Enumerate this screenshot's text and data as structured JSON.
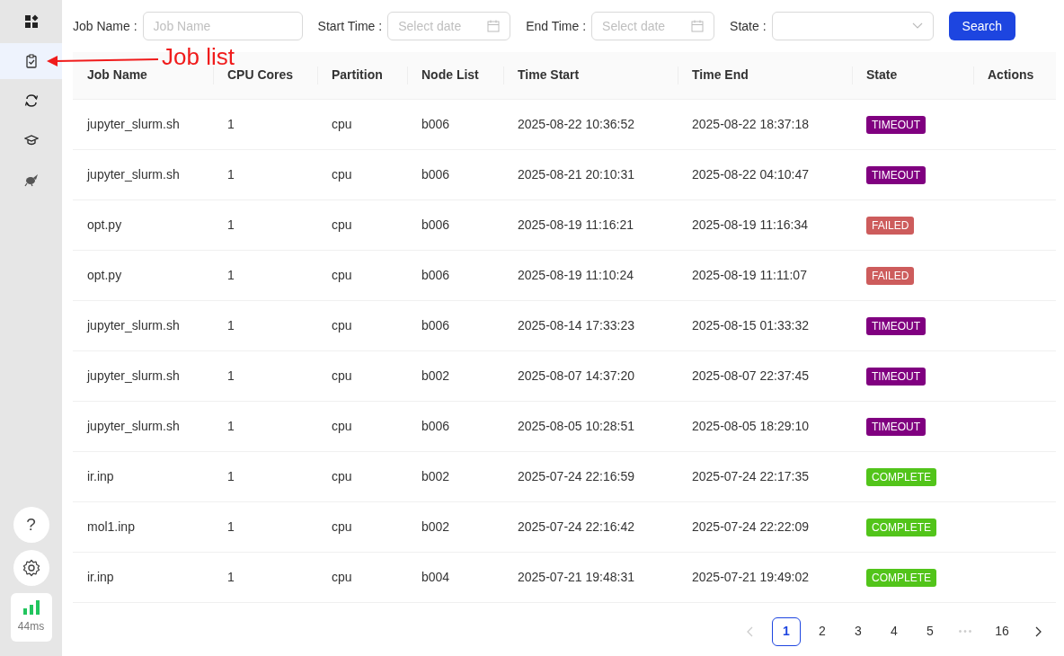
{
  "sidebar": {
    "items": [
      {
        "kind": "grid",
        "selected": false
      },
      {
        "kind": "clipboard",
        "selected": true
      },
      {
        "kind": "cycle",
        "selected": false
      },
      {
        "kind": "cap",
        "selected": false
      },
      {
        "kind": "bird",
        "selected": false
      }
    ],
    "bottom": [
      {
        "kind": "help",
        "text": "?"
      },
      {
        "kind": "settings"
      }
    ],
    "latency": "44ms"
  },
  "annotation": {
    "text": "Job list"
  },
  "filters": [
    {
      "kind": "text",
      "label": "Job Name :",
      "placeholder": "Job Name"
    },
    {
      "kind": "date",
      "label": "Start Time :",
      "placeholder": "Select date"
    },
    {
      "kind": "date",
      "label": "End Time :",
      "placeholder": "Select date"
    },
    {
      "kind": "select",
      "label": "State :"
    }
  ],
  "search_button": "Search",
  "table": {
    "columns": [
      "Job Name",
      "CPU Cores",
      "Partition",
      "Node List",
      "Time Start",
      "Time End",
      "State",
      "Actions"
    ],
    "rows": [
      {
        "job": "jupyter_slurm.sh",
        "cores": "1",
        "partition": "cpu",
        "nodes": "b006",
        "start": "2025-08-22 10:36:52",
        "end": "2025-08-22 18:37:18",
        "state": "TIMEOUT",
        "color": "#800080"
      },
      {
        "job": "jupyter_slurm.sh",
        "cores": "1",
        "partition": "cpu",
        "nodes": "b006",
        "start": "2025-08-21 20:10:31",
        "end": "2025-08-22 04:10:47",
        "state": "TIMEOUT",
        "color": "#800080"
      },
      {
        "job": "opt.py",
        "cores": "1",
        "partition": "cpu",
        "nodes": "b006",
        "start": "2025-08-19 11:16:21",
        "end": "2025-08-19 11:16:34",
        "state": "FAILED",
        "color": "#cd5c5c"
      },
      {
        "job": "opt.py",
        "cores": "1",
        "partition": "cpu",
        "nodes": "b006",
        "start": "2025-08-19 11:10:24",
        "end": "2025-08-19 11:11:07",
        "state": "FAILED",
        "color": "#cd5c5c"
      },
      {
        "job": "jupyter_slurm.sh",
        "cores": "1",
        "partition": "cpu",
        "nodes": "b006",
        "start": "2025-08-14 17:33:23",
        "end": "2025-08-15 01:33:32",
        "state": "TIMEOUT",
        "color": "#800080"
      },
      {
        "job": "jupyter_slurm.sh",
        "cores": "1",
        "partition": "cpu",
        "nodes": "b002",
        "start": "2025-08-07 14:37:20",
        "end": "2025-08-07 22:37:45",
        "state": "TIMEOUT",
        "color": "#800080"
      },
      {
        "job": "jupyter_slurm.sh",
        "cores": "1",
        "partition": "cpu",
        "nodes": "b006",
        "start": "2025-08-05 10:28:51",
        "end": "2025-08-05 18:29:10",
        "state": "TIMEOUT",
        "color": "#800080"
      },
      {
        "job": "ir.inp",
        "cores": "1",
        "partition": "cpu",
        "nodes": "b002",
        "start": "2025-07-24 22:16:59",
        "end": "2025-07-24 22:17:35",
        "state": "COMPLETE",
        "color": "#52c41a"
      },
      {
        "job": "mol1.inp",
        "cores": "1",
        "partition": "cpu",
        "nodes": "b002",
        "start": "2025-07-24 22:16:42",
        "end": "2025-07-24 22:22:09",
        "state": "COMPLETE",
        "color": "#52c41a"
      },
      {
        "job": "ir.inp",
        "cores": "1",
        "partition": "cpu",
        "nodes": "b004",
        "start": "2025-07-21 19:48:31",
        "end": "2025-07-21 19:49:02",
        "state": "COMPLETE",
        "color": "#52c41a"
      }
    ]
  },
  "pagination": {
    "prev_disabled": true,
    "next_disabled": false,
    "items": [
      {
        "kind": "page",
        "text": "1",
        "selected": true
      },
      {
        "kind": "page",
        "text": "2",
        "selected": false
      },
      {
        "kind": "page",
        "text": "3",
        "selected": false
      },
      {
        "kind": "page",
        "text": "4",
        "selected": false
      },
      {
        "kind": "page",
        "text": "5",
        "selected": false
      },
      {
        "kind": "ellipsis",
        "text": "•••"
      },
      {
        "kind": "page",
        "text": "16",
        "selected": false
      }
    ]
  }
}
